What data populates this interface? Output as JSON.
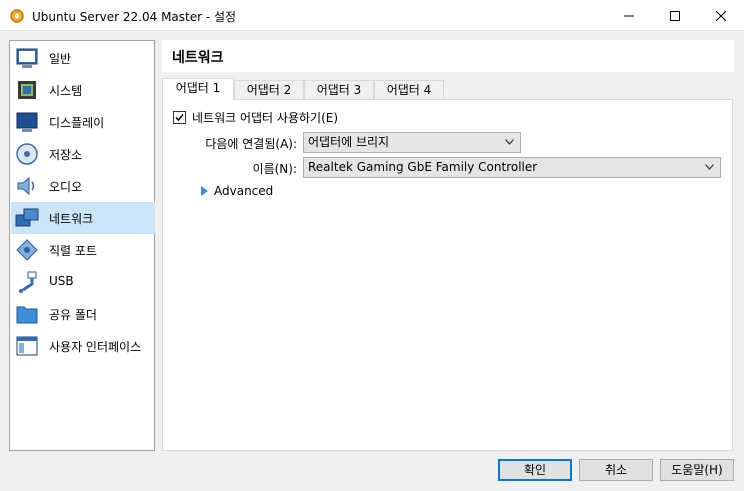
{
  "window": {
    "title": "Ubuntu Server 22.04 Master - 설정",
    "icon": "gear-icon"
  },
  "sidebar": {
    "items": [
      {
        "label": "일반",
        "icon": "general-icon"
      },
      {
        "label": "시스템",
        "icon": "system-chip-icon"
      },
      {
        "label": "디스플레이",
        "icon": "monitor-icon"
      },
      {
        "label": "저장소",
        "icon": "disk-icon"
      },
      {
        "label": "오디오",
        "icon": "speaker-icon"
      },
      {
        "label": "네트워크",
        "icon": "network-icon",
        "selected": true
      },
      {
        "label": "직렬 포트",
        "icon": "serial-port-icon"
      },
      {
        "label": "USB",
        "icon": "usb-icon"
      },
      {
        "label": "공유 폴더",
        "icon": "folder-icon"
      },
      {
        "label": "사용자 인터페이스",
        "icon": "user-interface-icon"
      }
    ]
  },
  "page": {
    "title": "네트워크"
  },
  "tabs": [
    {
      "label": "어댑터 1",
      "active": true
    },
    {
      "label": "어댑터 2"
    },
    {
      "label": "어댑터 3"
    },
    {
      "label": "어댑터 4"
    }
  ],
  "adapter": {
    "enable_label": "네트워크 어댑터 사용하기(E)",
    "enabled": true,
    "attached_label": "다음에 연결됨(A):",
    "attached_value": "어댑터에 브리지",
    "name_label": "이름(N):",
    "name_value": "Realtek Gaming GbE Family Controller",
    "advanced_label": "Advanced"
  },
  "buttons": {
    "ok": "확인",
    "cancel": "취소",
    "help": "도움말(H)"
  },
  "colors": {
    "selection": "#cce4f7",
    "accent": "#0078d7"
  }
}
